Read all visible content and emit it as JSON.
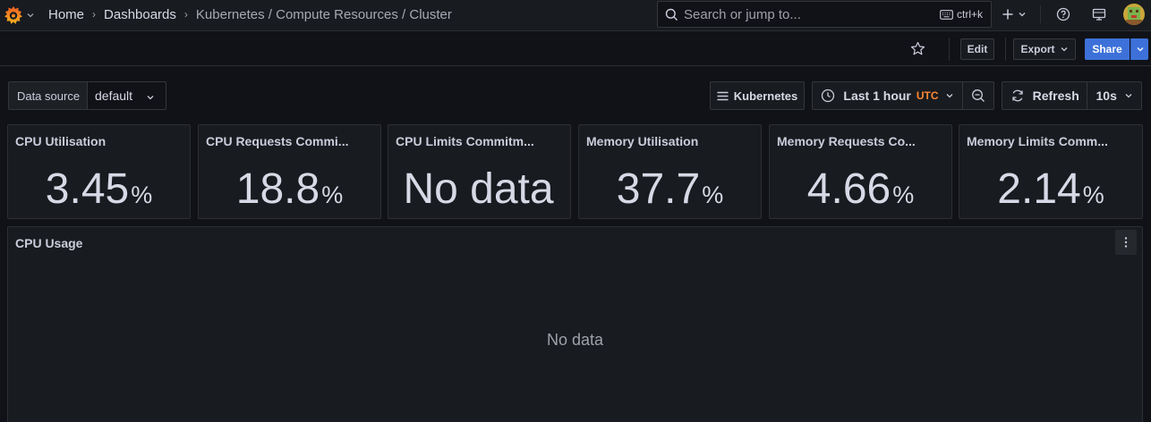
{
  "breadcrumbs": {
    "home": "Home",
    "dashboards": "Dashboards",
    "current": "Kubernetes / Compute Resources / Cluster"
  },
  "search": {
    "placeholder": "Search or jump to...",
    "shortcut": "ctrl+k"
  },
  "toolbar": {
    "edit": "Edit",
    "export": "Export",
    "share": "Share"
  },
  "controls": {
    "datasource_label": "Data source",
    "datasource_value": "default",
    "kubernetes_link": "Kubernetes",
    "time_range": "Last 1 hour",
    "timezone": "UTC",
    "refresh": "Refresh",
    "refresh_interval": "10s"
  },
  "stats": [
    {
      "title": "CPU Utilisation",
      "value": "3.45",
      "unit": "%"
    },
    {
      "title": "CPU Requests Commi...",
      "value": "18.8",
      "unit": "%"
    },
    {
      "title": "CPU Limits Commitm...",
      "value": "No data",
      "unit": ""
    },
    {
      "title": "Memory Utilisation",
      "value": "37.7",
      "unit": "%"
    },
    {
      "title": "Memory Requests Co...",
      "value": "4.66",
      "unit": "%"
    },
    {
      "title": "Memory Limits Comm...",
      "value": "2.14",
      "unit": "%"
    }
  ],
  "cpu_usage": {
    "title": "CPU Usage",
    "no_data": "No data"
  },
  "colors": {
    "accent": "#3d71d9",
    "timezone": "#ff8833",
    "background": "#111217",
    "panel": "#181b1f"
  }
}
